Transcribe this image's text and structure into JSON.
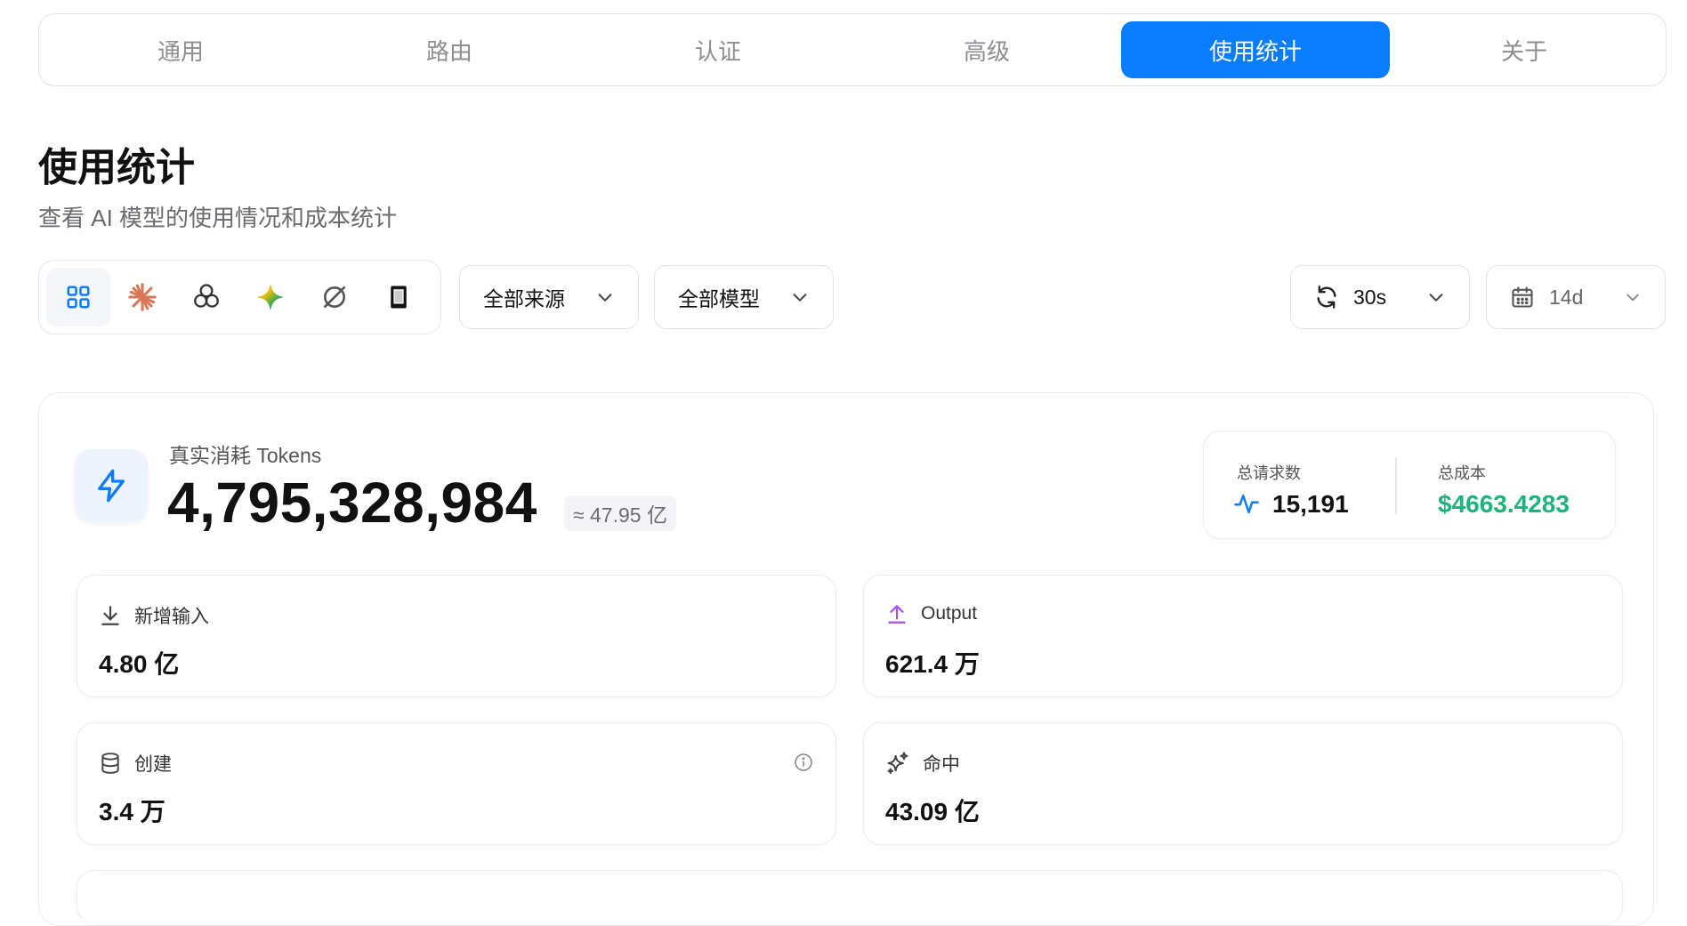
{
  "tabs": [
    {
      "label": "通用"
    },
    {
      "label": "路由"
    },
    {
      "label": "认证"
    },
    {
      "label": "高级"
    },
    {
      "label": "使用统计",
      "active": true
    },
    {
      "label": "关于"
    }
  ],
  "page": {
    "title": "使用统计",
    "subtitle": "查看 AI 模型的使用情况和成本统计"
  },
  "toolbar": {
    "providers": [
      "grid-icon",
      "claude-icon",
      "openai-icon",
      "gemini-icon",
      "slash-circle-icon",
      "phone-icon"
    ],
    "source_filter": "全部来源",
    "model_filter": "全部模型",
    "refresh_interval": "30s",
    "date_range": "14d"
  },
  "tokens": {
    "label": "真实消耗 Tokens",
    "value": "4,795,328,984",
    "approx": "≈ 47.95 亿"
  },
  "summary": {
    "requests_label": "总请求数",
    "requests_value": "15,191",
    "cost_label": "总成本",
    "cost_value": "$4663.4283"
  },
  "stats": {
    "input": {
      "label": "新增输入",
      "value": "4.80 亿"
    },
    "output": {
      "label": "Output",
      "value": "621.4 万"
    },
    "create": {
      "label": "创建",
      "value": "3.4 万"
    },
    "hit": {
      "label": "命中",
      "value": "43.09 亿"
    }
  },
  "colors": {
    "accent": "#0a7cff",
    "cost_green": "#1db37a",
    "output_purple": "#a54ff0"
  }
}
